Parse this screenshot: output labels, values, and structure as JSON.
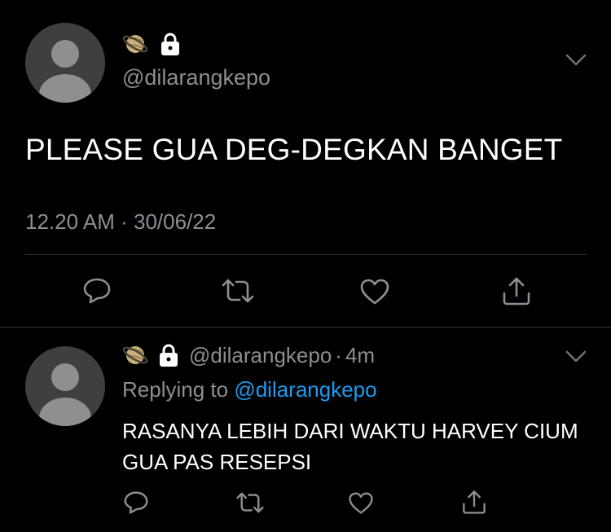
{
  "main_tweet": {
    "handle": "@dilarangkepo",
    "text": "PLEASE GUA DEG-DEGKAN BANGET",
    "time": "12.20 AM",
    "separator": "·",
    "date": "30/06/22",
    "emoji_icons": [
      "ringed-planet-icon",
      "lock-icon"
    ],
    "actions": [
      "reply-icon",
      "retweet-icon",
      "like-icon",
      "share-icon"
    ]
  },
  "reply_tweet": {
    "handle": "@dilarangkepo",
    "separator": "·",
    "time_ago": "4m",
    "replying_prefix": "Replying to",
    "replying_to": "@dilarangkepo",
    "text": "RASANYA LEBIH DARI WAKTU HARVEY CIUM GUA PAS RESEPSI",
    "emoji_icons": [
      "ringed-planet-icon",
      "lock-icon"
    ],
    "actions": [
      "reply-icon",
      "retweet-icon",
      "like-icon",
      "share-icon"
    ]
  },
  "colors": {
    "background": "#000000",
    "text_primary": "#ffffff",
    "text_secondary": "#8b8f94",
    "accent": "#1d9bf0",
    "divider": "#2f3336",
    "avatar_bg": "#3f3f3f",
    "avatar_fg": "#8f8f8f"
  }
}
